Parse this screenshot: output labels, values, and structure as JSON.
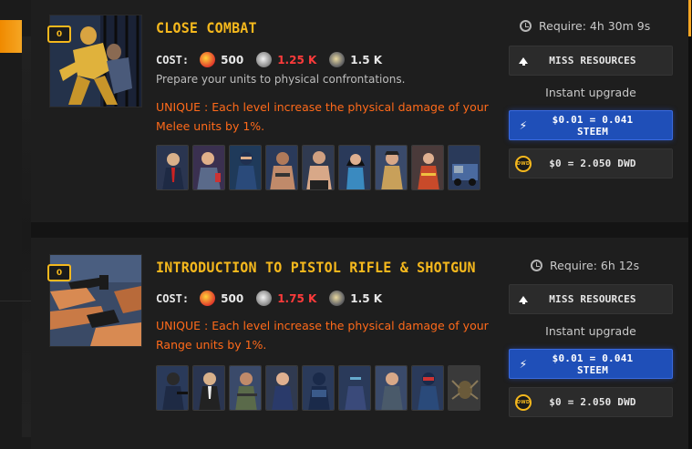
{
  "skills": [
    {
      "level": "0",
      "title": "CLOSE COMBAT",
      "cost_label": "COST:",
      "costs": [
        {
          "icon": "food-icon",
          "value": "500",
          "insufficient": false
        },
        {
          "icon": "weapons-icon",
          "value": "1.25 K",
          "insufficient": true
        },
        {
          "icon": "alcohol-icon",
          "value": "1.5 K",
          "insufficient": false
        }
      ],
      "description": "Prepare your units to physical confrontations.",
      "unique": "UNIQUE : Each level increase the physical damage of your Melee units by 1%.",
      "require": "Require: 4h 30m 9s",
      "miss_button": "MISS RESOURCES",
      "instant_label": "Instant upgrade",
      "steem_button": "$0.01 = 0.041 STEEM",
      "dwd_button": "$0 = 2.050 DWD",
      "dwd_icon_text": "DWD",
      "units": [
        "unit-suit-icon",
        "unit-bartender-icon",
        "unit-ninja-icon",
        "unit-brawler-icon",
        "unit-boxer-icon",
        "unit-woman-icon",
        "unit-pirate-icon",
        "unit-samurai-icon",
        "unit-truck-icon"
      ]
    },
    {
      "level": "0",
      "title": "INTRODUCTION TO PISTOL RIFLE & SHOTGUN",
      "cost_label": "COST:",
      "costs": [
        {
          "icon": "food-icon",
          "value": "500",
          "insufficient": false
        },
        {
          "icon": "weapons-icon",
          "value": "1.75 K",
          "insufficient": true
        },
        {
          "icon": "alcohol-icon",
          "value": "1.5 K",
          "insufficient": false
        }
      ],
      "unique": "UNIQUE : Each level increase the physical damage of your Range units by 1%.",
      "require": "Require: 6h 12s",
      "miss_button": "MISS RESOURCES",
      "instant_label": "Instant upgrade",
      "steem_button": "$0.01 = 0.041 STEEM",
      "dwd_button": "$0 = 2.050 DWD",
      "dwd_icon_text": "DWD",
      "units": [
        "unit-gunman-icon",
        "unit-agent-icon",
        "unit-soldier-icon",
        "unit-bald-icon",
        "unit-swat-icon",
        "unit-trooper-icon",
        "unit-sniper-icon",
        "unit-commando-icon",
        "unit-spider-icon"
      ]
    }
  ],
  "colors": {
    "accent": "#f5b81d",
    "warning": "#ff6a1a",
    "insufficient": "#ff3b3b",
    "steem_button": "#1f4fb8"
  }
}
